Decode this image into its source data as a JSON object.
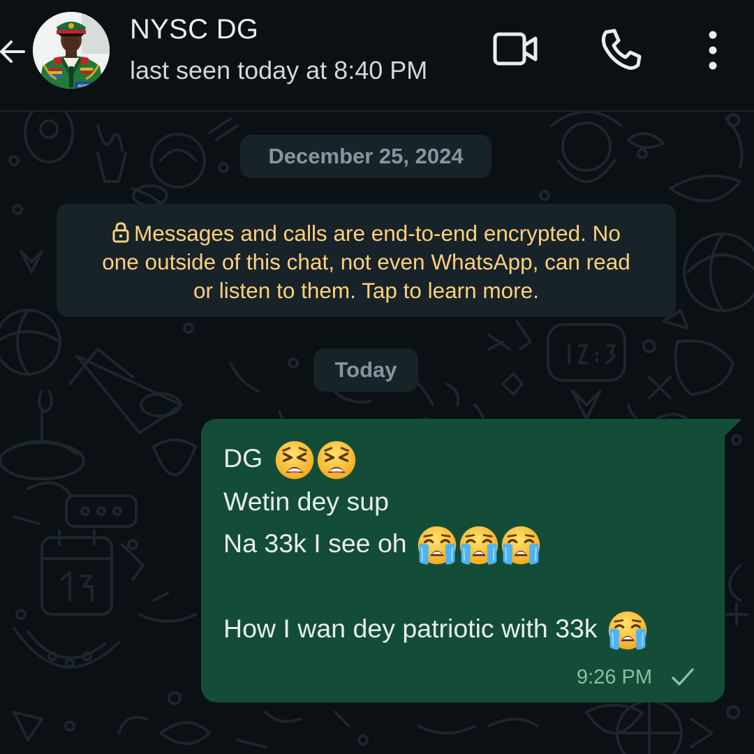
{
  "header": {
    "contact_name": "NYSC DG",
    "status": "last seen today at 8:40 PM",
    "icons": {
      "back": "arrow-left-icon",
      "video": "video-call-icon",
      "call": "phone-icon",
      "menu": "more-vertical-icon"
    }
  },
  "chat": {
    "date_chip": "December 25, 2024",
    "encryption_notice": "Messages and calls are end-to-end encrypted. No one outside of this chat, not even WhatsApp, can read or listen to them. Tap to learn more.",
    "encryption_lines": [
      "Messages and calls are end-to-end encrypted. No",
      "one outside of this chat, not even WhatsApp, can read",
      "or listen to them. Tap to learn more."
    ],
    "today_chip": "Today",
    "messages": [
      {
        "direction": "outgoing",
        "lines": [
          "DG",
          "Wetin dey sup",
          "Na 33k I see oh",
          "",
          "How I wan dey patriotic with 33k"
        ],
        "line_emojis": [
          [
            "tired-face-emoji",
            "tired-face-emoji"
          ],
          [],
          [
            "loudly-crying-face-emoji",
            "loudly-crying-face-emoji",
            "loudly-crying-face-emoji"
          ],
          [],
          [
            "loudly-crying-face-emoji"
          ]
        ],
        "time": "9:26 PM",
        "status_icon": "single-check-icon"
      }
    ]
  },
  "colors": {
    "background": "#0b1014",
    "chip_bg": "#182229",
    "chip_text": "#8696a0",
    "encryption_text": "#ffd279",
    "outgoing_bubble": "#144d37",
    "primary_text": "#e9edef"
  }
}
